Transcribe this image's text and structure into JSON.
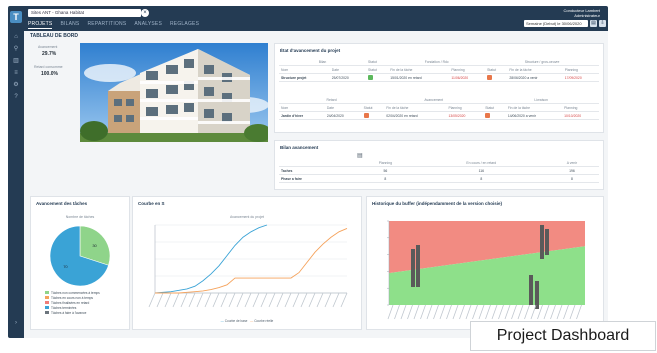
{
  "app": {
    "search_text": "Sites ANT - Ghana Habitat",
    "search_clear": "×",
    "tabs": [
      {
        "label": "PROJETS"
      },
      {
        "label": "BILANS"
      },
      {
        "label": "REPARTITIONS"
      },
      {
        "label": "ANALYSES"
      },
      {
        "label": "REGLAGES"
      }
    ],
    "user_name": "Conducteur Lambert",
    "user_role": "Administrateur",
    "date_select": "Semaine (Debut) le 30/06/2020",
    "logo_letter": "T"
  },
  "page": {
    "title": "TABLEAU DE BORD",
    "kpis": [
      {
        "label": "Avancement",
        "value": "29.7%"
      },
      {
        "label": "Retard consomme",
        "value": "100.0%"
      }
    ]
  },
  "etat": {
    "title": "État d'avancement du projet",
    "block1_header": [
      "Bilan",
      "Statut",
      "Fondation / Rdc",
      "Structure / gros-oeuvre"
    ],
    "block1_cols": [
      "Nom",
      "Date",
      "Statut",
      "Fin de la tâche",
      "Planning",
      "Statut",
      "Fin de la tâche",
      "Planning"
    ],
    "block1_row": [
      "Structure projet",
      "25/07/2020",
      "",
      "15/01/2020 en retard",
      "11/06/2020",
      "",
      "28/06/2020 a venir",
      "17/09/2020"
    ],
    "block2_header": [
      "Retard",
      "Avancement",
      "Livraison"
    ],
    "block2_cols": [
      "Nom",
      "Date",
      "Statut",
      "Fin de la tâche",
      "Planning",
      "Statut",
      "Fin de la tâche",
      "Planning"
    ],
    "block2_row": [
      "Jardin d'hiver",
      "24/04/2020",
      "",
      "02/04/2020 en retard",
      "13/05/2020",
      "",
      "14/06/2020 a venir",
      "10/10/2020"
    ]
  },
  "bilan": {
    "title": "Bilan avancement",
    "columns": [
      "",
      "Planning",
      "En cours / en retard",
      "A venir"
    ],
    "rows": [
      {
        "label": "Taches",
        "values": [
          "56",
          "116",
          "196"
        ]
      },
      {
        "label": "Phase a faire",
        "values": [
          "8",
          "8",
          "8"
        ]
      }
    ]
  },
  "avancement": {
    "title": "Avancement des tâches",
    "subtitle": "Nombre de tâches",
    "legend": [
      "Tâches non commencées à temps",
      "Tâches en cours non à temps",
      "Tâches finalisées en retard",
      "Tâches terminées",
      "Tâches à faire à l'avance"
    ]
  },
  "courbe": {
    "title": "Courbe en S",
    "subtitle": "Avancement du projet",
    "legend": [
      "Courbe de base",
      "Courbe réelle"
    ]
  },
  "historique": {
    "title": "Historique du buffer (indépendamment de la version choisie)"
  },
  "caption": "Project Dashboard",
  "colors": {
    "nav": "#243b53",
    "green": "#8fd48a",
    "blue": "#3aa3d6",
    "orange": "#f5a25b",
    "red": "#f07d78",
    "buffer_green": "#8ee08a",
    "buffer_red": "#f28b82"
  },
  "chart_data": [
    {
      "type": "pie",
      "title": "Avancement des tâches",
      "labels": [
        "Tâches non commencées à temps",
        "Tâches en cours non à temps",
        "Tâches finalisées en retard",
        "Tâches terminées",
        "Tâches à faire à l'avance"
      ],
      "values": [
        30,
        0,
        0,
        70,
        0
      ],
      "data_labels": [
        "30",
        "70"
      ]
    },
    {
      "type": "line",
      "title": "Avancement du projet",
      "x_ticks": 25,
      "series": [
        {
          "name": "Courbe de base",
          "values": [
            0,
            1,
            2,
            4,
            6,
            10,
            18,
            28,
            40,
            55,
            70,
            82,
            90,
            96,
            100
          ]
        },
        {
          "name": "Courbe réelle",
          "values": [
            0,
            0,
            0,
            0,
            1,
            2,
            3,
            5,
            8,
            12,
            22,
            22,
            22,
            22,
            22,
            22,
            22,
            22,
            30,
            45,
            60,
            72,
            82,
            90,
            95
          ]
        }
      ],
      "ylim": [
        0,
        100
      ]
    },
    {
      "type": "area",
      "title": "Historique du buffer (indépendamment de la version choisie)",
      "zones": [
        "green",
        "red"
      ],
      "ylim": [
        0,
        120
      ]
    }
  ]
}
